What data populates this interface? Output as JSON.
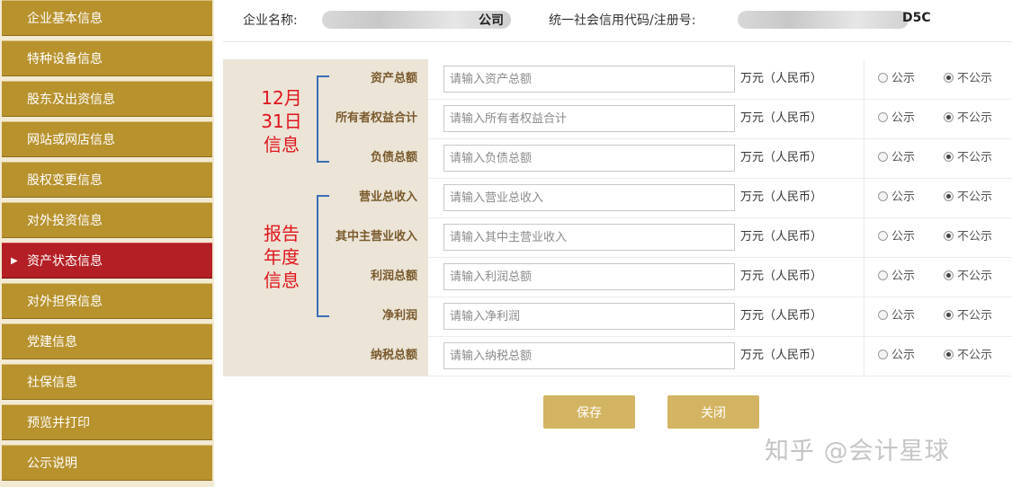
{
  "sidebar": {
    "items": [
      {
        "label": "企业基本信息"
      },
      {
        "label": "特种设备信息"
      },
      {
        "label": "股东及出资信息"
      },
      {
        "label": "网站或网店信息"
      },
      {
        "label": "股权变更信息"
      },
      {
        "label": "对外投资信息"
      },
      {
        "label": "资产状态信息",
        "active": true
      },
      {
        "label": "对外担保信息"
      },
      {
        "label": "党建信息"
      },
      {
        "label": "社保信息"
      },
      {
        "label": "预览并打印"
      },
      {
        "label": "公示说明"
      }
    ],
    "active_marker": "▶"
  },
  "header": {
    "company_label": "企业名称:",
    "company_visible_suffix": "公司",
    "credit_label": "统一社会信用代码/注册号:",
    "credit_visible_suffix": "D5C"
  },
  "groups": {
    "dec31": "12月\n31日\n信息",
    "annual": "报告\n年度\n信息"
  },
  "rows": [
    {
      "label": "资产总额",
      "placeholder": "请输入资产总额",
      "unit": "万元（人民币）",
      "public_label": "公示",
      "private_label": "不公示",
      "selected": "不公示"
    },
    {
      "label": "所有者权益合计",
      "placeholder": "请输入所有者权益合计",
      "unit": "万元（人民币）",
      "public_label": "公示",
      "private_label": "不公示",
      "selected": "不公示"
    },
    {
      "label": "负债总额",
      "placeholder": "请输入负债总额",
      "unit": "万元（人民币）",
      "public_label": "公示",
      "private_label": "不公示",
      "selected": "不公示"
    },
    {
      "label": "营业总收入",
      "placeholder": "请输入营业总收入",
      "unit": "万元（人民币）",
      "public_label": "公示",
      "private_label": "不公示",
      "selected": "不公示"
    },
    {
      "label": "其中主营业收入",
      "placeholder": "请输入其中主营业收入",
      "unit": "万元（人民币）",
      "public_label": "公示",
      "private_label": "不公示",
      "selected": "不公示"
    },
    {
      "label": "利润总额",
      "placeholder": "请输入利润总额",
      "unit": "万元（人民币）",
      "public_label": "公示",
      "private_label": "不公示",
      "selected": "不公示"
    },
    {
      "label": "净利润",
      "placeholder": "请输入净利润",
      "unit": "万元（人民币）",
      "public_label": "公示",
      "private_label": "不公示",
      "selected": "不公示"
    },
    {
      "label": "纳税总额",
      "placeholder": "请输入纳税总额",
      "unit": "万元（人民币）",
      "public_label": "公示",
      "private_label": "不公示",
      "selected": "不公示"
    }
  ],
  "buttons": {
    "save": "保存",
    "close": "关闭"
  },
  "watermark": "知乎 @会计星球",
  "colors": {
    "sidebar": "#b7922d",
    "sidebar_active": "#b31f24",
    "button": "#d3b462",
    "annotation_red": "#e0151c",
    "bracket_blue": "#3a6fb5"
  }
}
